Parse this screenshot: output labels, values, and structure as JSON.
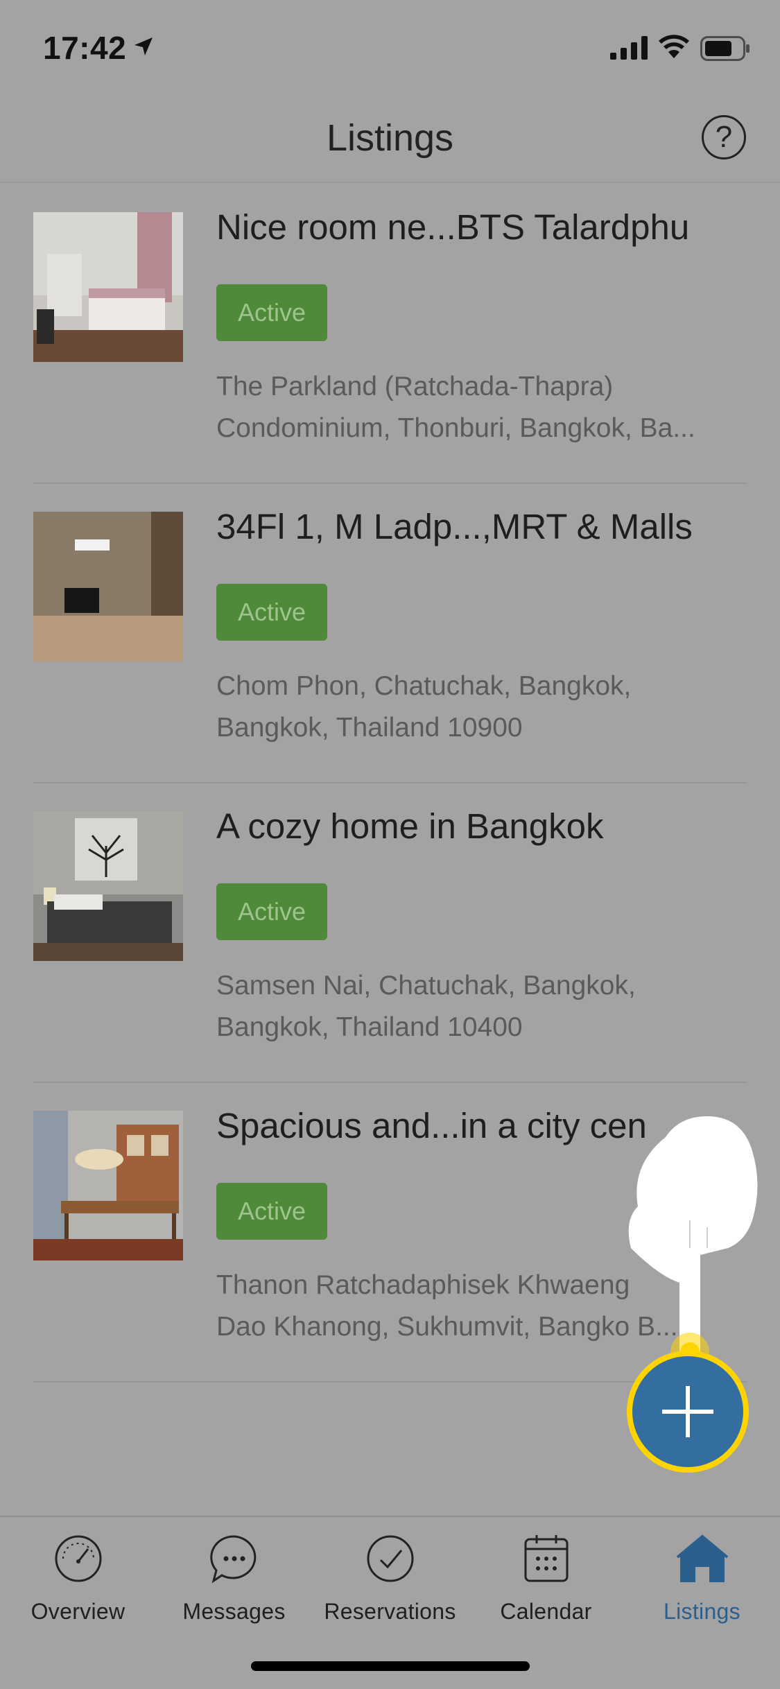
{
  "status_bar": {
    "time": "17:42"
  },
  "header": {
    "title": "Listings",
    "help_symbol": "?"
  },
  "listings": [
    {
      "title": "Nice room ne...BTS Talardphu",
      "status": "Active",
      "address_lines": [
        "The Parkland (Ratchada-Thapra)",
        "Condominium, Thonburi, Bangkok, Ba..."
      ]
    },
    {
      "title": "34Fl 1, M Ladp...,MRT & Malls",
      "status": "Active",
      "address_lines": [
        "Chom Phon, Chatuchak, Bangkok,",
        "Bangkok, Thailand 10900"
      ]
    },
    {
      "title": "A cozy home in Bangkok",
      "status": "Active",
      "address_lines": [
        "Samsen Nai, Chatuchak, Bangkok,",
        "Bangkok, Thailand 10400"
      ]
    },
    {
      "title": "Spacious and...in a city cen",
      "status": "Active",
      "address_lines": [
        "Thanon Ratchadaphisek Khwaeng",
        "Dao Khanong, Sukhumvit, Bangko B..."
      ]
    }
  ],
  "tabs": [
    {
      "label": "Overview",
      "icon": "gauge-icon"
    },
    {
      "label": "Messages",
      "icon": "chat-bubble-icon"
    },
    {
      "label": "Reservations",
      "icon": "check-circle-icon"
    },
    {
      "label": "Calendar",
      "icon": "calendar-icon"
    },
    {
      "label": "Listings",
      "icon": "home-icon",
      "active": true
    }
  ],
  "colors": {
    "overlay_background": "#a3a3a3",
    "active_badge": "#4f8a3a",
    "fab": "#346ea0",
    "fab_highlight": "#ffd400",
    "active_tab": "#2a5f8e"
  }
}
